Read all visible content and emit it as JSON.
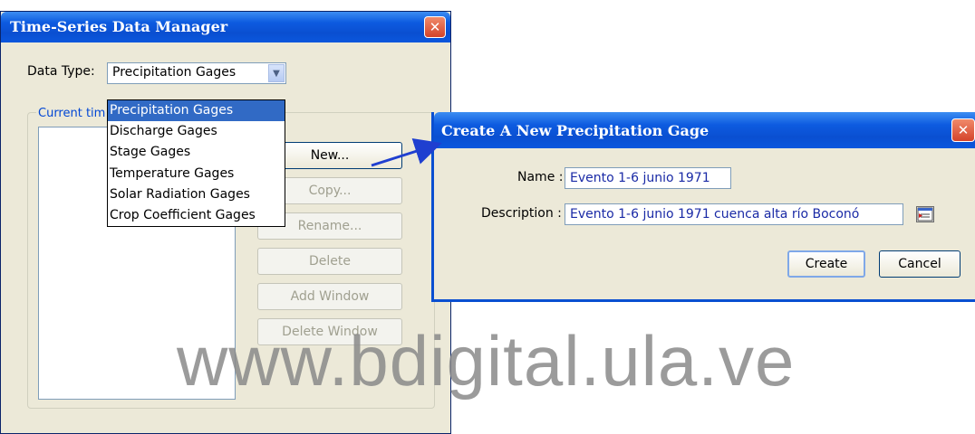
{
  "main_window": {
    "title": "Time-Series Data Manager",
    "data_type_label": "Data Type:",
    "data_type_value": "Precipitation Gages",
    "group_label": "Current tim",
    "dropdown_options": [
      "Precipitation Gages",
      "Discharge Gages",
      "Stage Gages",
      "Temperature Gages",
      "Solar Radiation Gages",
      "Crop Coefficient Gages"
    ],
    "buttons": {
      "new": "New...",
      "copy": "Copy...",
      "rename": "Rename...",
      "delete": "Delete",
      "add_window": "Add Window",
      "delete_window": "Delete Window"
    }
  },
  "dialog": {
    "title": "Create A New Precipitation Gage",
    "name_label": "Name :",
    "name_value": "Evento 1-6 junio 1971",
    "description_label": "Description :",
    "description_value": "Evento 1-6 junio 1971 cuenca alta río Boconó",
    "create_label": "Create",
    "cancel_label": "Cancel"
  },
  "watermark": "www.bdigital.ula.ve",
  "icons": {
    "close": "close-icon",
    "dropdown": "chevron-down-icon",
    "description_editor": "description-editor-icon"
  },
  "colors": {
    "titlebar": "#0a4fd1",
    "selection": "#316ac5",
    "close_button": "#d4432a",
    "arrow": "#1f3fd0"
  }
}
